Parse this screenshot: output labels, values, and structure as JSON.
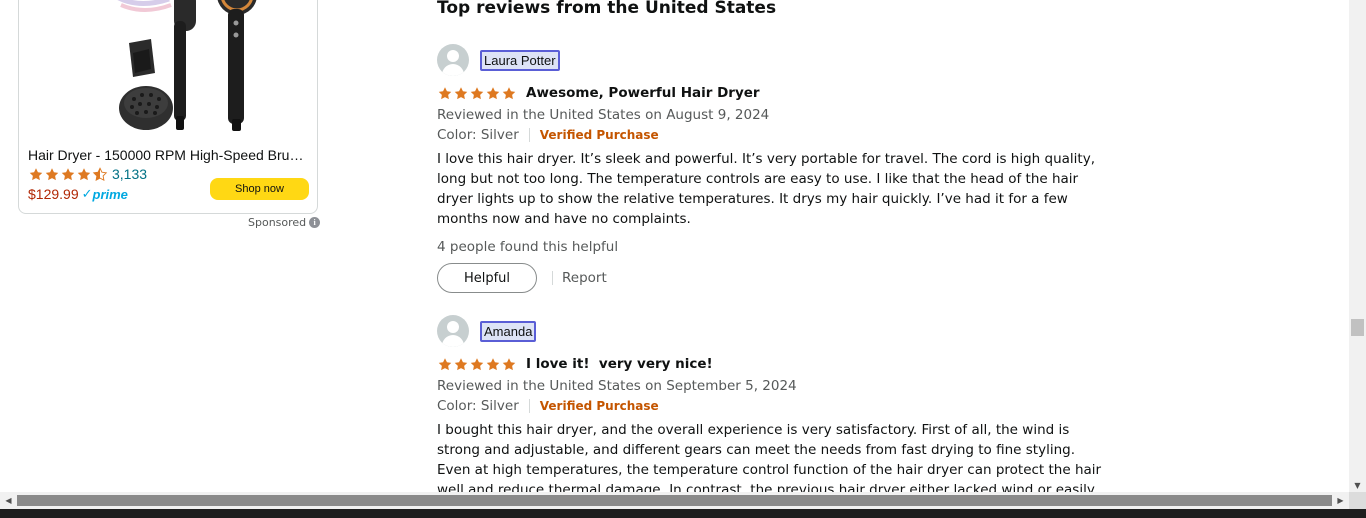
{
  "ad": {
    "title": "Hair Dryer - 150000 RPM High-Speed Bru…",
    "rating": 4.5,
    "rating_count": "3,133",
    "price": "$129.99",
    "prime_label": "prime",
    "shop_button": "Shop now",
    "sponsored_label": "Sponsored",
    "info_icon": "i",
    "image_icon": "hair-dryer-product-image"
  },
  "reviews_heading": "Top reviews from the United States",
  "reviews": [
    {
      "reviewer": "Laura Potter",
      "rating": 5,
      "title": "Awesome, Powerful Hair Dryer",
      "date": "Reviewed in the United States on August 9, 2024",
      "color": "Color: Silver",
      "verified": "Verified Purchase",
      "body": "I love this hair dryer. It’s sleek and powerful. It’s very portable for travel. The cord is high quality, long but not too long. The temperature controls are easy to use. I like that the head of the hair dryer lights up to show the relative temperatures. It drys my hair quickly. I’ve had it for a few months now and have no complaints.",
      "helpful_count": "4 people found this helpful",
      "helpful_button": "Helpful",
      "report": "Report"
    },
    {
      "reviewer": "Amanda",
      "rating": 5,
      "title": "I love it!  very very nice!",
      "date": "Reviewed in the United States on September 5, 2024",
      "color": "Color: Silver",
      "verified": "Verified Purchase",
      "body": "I bought this hair dryer, and the overall experience is very satisfactory. First of all, the wind is strong and adjustable, and different gears can meet the needs from fast drying to fine styling. Even at high temperatures, the temperature control function of the hair dryer can protect the hair well and reduce thermal damage. In contrast, the previous hair dryer either lacked wind or easily overheated, causing the"
    }
  ],
  "colors": {
    "star": "#de7921",
    "link": "#007185",
    "price": "#b12704",
    "verified": "#c45500",
    "shop_button": "#ffd814",
    "prime": "#00a8e1"
  }
}
